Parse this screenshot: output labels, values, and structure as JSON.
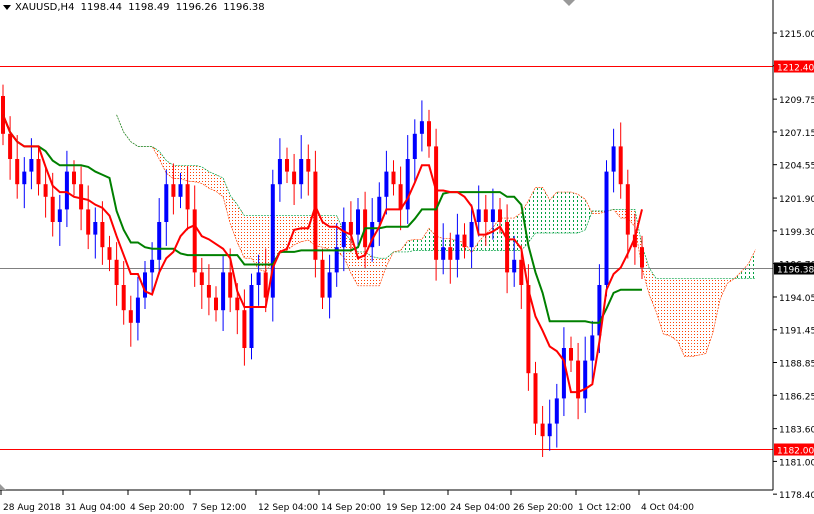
{
  "header": {
    "symbol": "XAUUSD,H4",
    "open": "1198.44",
    "high": "1198.49",
    "low": "1196.26",
    "close": "1196.38"
  },
  "chart_data": {
    "type": "candlestick",
    "title": "XAUUSD,H4",
    "ylim": [
      1177.5,
      1218.2
    ],
    "y_ticks": [
      "1215.00",
      "1212.40",
      "1209.75",
      "1207.15",
      "1204.55",
      "1201.90",
      "1199.30",
      "1196.70",
      "1194.05",
      "1191.45",
      "1188.85",
      "1186.25",
      "1183.60",
      "1181.00",
      "1178.40"
    ],
    "x_ticks": [
      "28 Aug 2018",
      "31 Aug 04:00",
      "4 Sep 20:00",
      "7 Sep 12:00",
      "12 Sep 04:00",
      "14 Sep 20:00",
      "19 Sep 12:00",
      "24 Sep 04:00",
      "26 Sep 20:00",
      "1 Oct 12:00",
      "4 Oct 04:00"
    ],
    "closes": [
      1207,
      1205,
      1203,
      1204,
      1205,
      1203,
      1202,
      1200,
      1201,
      1204,
      1203,
      1201,
      1199,
      1200,
      1198,
      1197,
      1195,
      1193,
      1192,
      1194,
      1196,
      1197,
      1200,
      1203,
      1202,
      1203,
      1201,
      1196,
      1195,
      1194,
      1193,
      1196,
      1194,
      1193,
      1190,
      1195,
      1196,
      1194,
      1203,
      1205,
      1204,
      1203,
      1205,
      1204,
      1197,
      1194,
      1196,
      1198,
      1200,
      1199,
      1201,
      1198,
      1200,
      1202,
      1204,
      1203,
      1201,
      1205,
      1207,
      1208,
      1206,
      1197,
      1198,
      1197,
      1199,
      1198,
      1200,
      1201,
      1200,
      1201,
      1200,
      1196,
      1197,
      1195,
      1188,
      1184,
      1183,
      1184,
      1186,
      1190,
      1189,
      1186,
      1189,
      1191,
      1195,
      1204,
      1206,
      1203,
      1199,
      1198,
      1196.38
    ],
    "first_open": 1210,
    "levels": [
      {
        "price": 1212.4,
        "label": "1212.40",
        "color": "#ff0000"
      },
      {
        "price": 1182.0,
        "label": "1182.00",
        "color": "#ff0000"
      },
      {
        "price": 1196.38,
        "label": "1196.38",
        "color": "#000000"
      }
    ],
    "indicator": "Ichimoku",
    "colors": {
      "bull": "#0000ff",
      "bear": "#ff0000",
      "tenkan": "#ff0000",
      "kijun": "#008000",
      "cloud_up": "#00a040",
      "cloud_down": "#ff4000"
    }
  }
}
